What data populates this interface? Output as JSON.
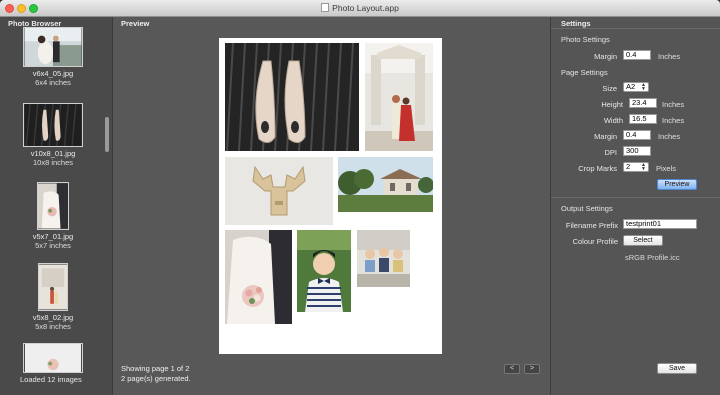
{
  "window": {
    "title": "Photo Layout.app"
  },
  "sidebar": {
    "header": "Photo Browser",
    "items": [
      {
        "name": "v6x4_05.jpg",
        "size": "6x4 inches"
      },
      {
        "name": "v10x8_01.jpg",
        "size": "10x8 inches"
      },
      {
        "name": "v5x7_01.jpg",
        "size": "5x7 inches"
      },
      {
        "name": "v5x8_02.jpg",
        "size": "5x8 inches"
      }
    ],
    "status": "Loaded 12 images"
  },
  "preview": {
    "header": "Preview",
    "page_info": "Showing page 1 of 2",
    "generated": "2 page(s) generated.",
    "prev_label": "<",
    "next_label": ">"
  },
  "settings": {
    "header": "Settings",
    "photo_settings": {
      "title": "Photo Settings",
      "margin_label": "Margin",
      "margin_value": "0.4",
      "margin_unit": "Inches"
    },
    "page_settings": {
      "title": "Page Settings",
      "size_label": "Size",
      "size_value": "A2",
      "height_label": "Height",
      "height_value": "23.4",
      "height_unit": "Inches",
      "width_label": "Width",
      "width_value": "16.5",
      "width_unit": "Inches",
      "margin_label": "Margin",
      "margin_value": "0.4",
      "margin_unit": "Inches",
      "dpi_label": "DPI",
      "dpi_value": "300",
      "crop_label": "Crop Marks",
      "crop_value": "2",
      "crop_unit": "Pixels",
      "preview_button": "Preview"
    },
    "output_settings": {
      "title": "Output Settings",
      "prefix_label": "Filename Prefix",
      "prefix_value": "testprint01",
      "profile_label": "Colour Profile",
      "select_button": "Select",
      "profile_name": "sRGB Profile.icc"
    },
    "save_button": "Save"
  },
  "colors": {
    "window_bg": "#525252",
    "preview_button_blue": "#7fb1ef"
  }
}
